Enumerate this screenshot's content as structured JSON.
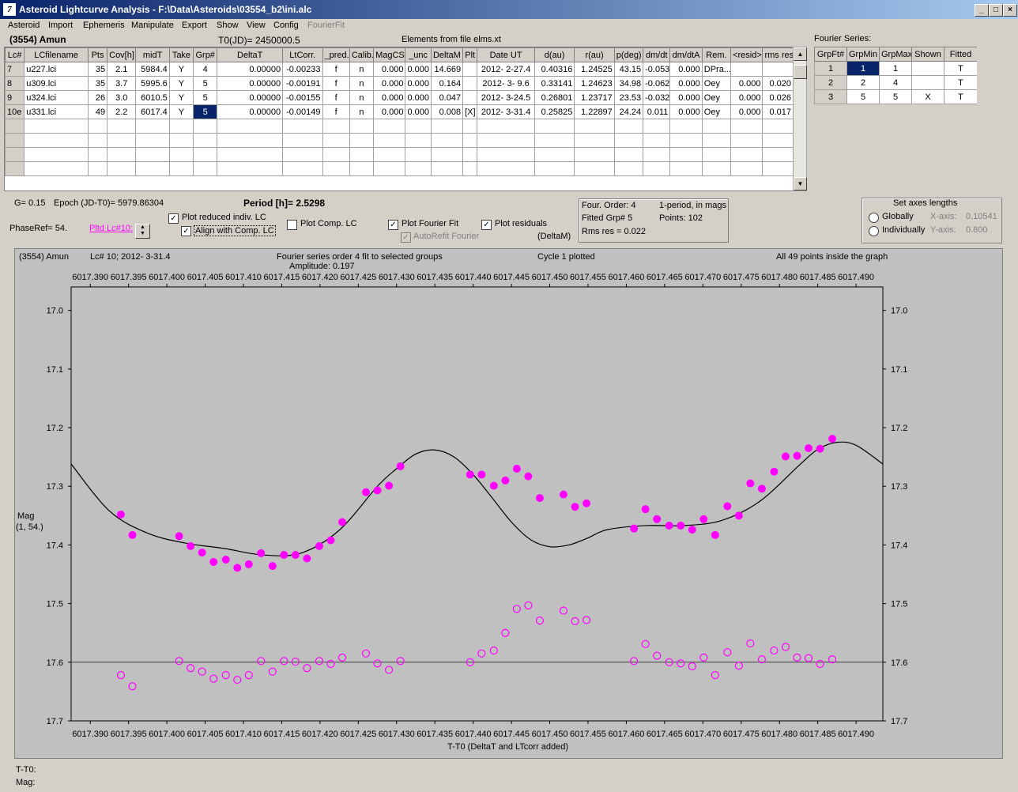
{
  "window": {
    "title": "Asteroid Lightcurve Analysis - F:\\Data\\Asteroids\\03554_b2\\ini.alc",
    "icon": "7"
  },
  "menu": [
    "Asteroid",
    "Import",
    "Ephemeris",
    "Manipulate",
    "Export",
    "Show",
    "View",
    "Config",
    "FourierFit"
  ],
  "header": {
    "asteroid": "(3554) Amun",
    "t0": "T0(JD)= 2450000.5",
    "elements": "Elements from file elms.xt"
  },
  "lc_table": {
    "columns": [
      "Lc#",
      "LCfilename",
      "Pts",
      "Cov[h]",
      "midT",
      "Take",
      "Grp#",
      "DeltaT",
      "LtCorr.",
      "_pred.",
      "Calib.",
      "MagCS",
      "_unc",
      "DeltaM",
      "Plt",
      "Date UT",
      "d(au)",
      "r(au)",
      "p(deg)",
      "dm/dt",
      "dm/dtA",
      "Rem.",
      "<resid>",
      "rms res"
    ],
    "rows": [
      [
        "7",
        "u227.lci",
        "35",
        "2.1",
        "5984.4",
        "Y",
        "4",
        "0.00000",
        "-0.00233",
        "f",
        "n",
        "0.000",
        "0.000",
        "14.669",
        "",
        "2012- 2-27.4",
        "0.40316",
        "1.24525",
        "43.15",
        "-0.053",
        "0.000",
        "DPra...",
        "",
        ""
      ],
      [
        "8",
        "u309.lci",
        "35",
        "3.7",
        "5995.6",
        "Y",
        "5",
        "0.00000",
        "-0.00191",
        "f",
        "n",
        "0.000",
        "0.000",
        "0.164",
        "",
        "2012- 3- 9.6",
        "0.33141",
        "1.24623",
        "34.98",
        "-0.062",
        "0.000",
        "Oey",
        "0.000",
        "0.020"
      ],
      [
        "9",
        "u324.lci",
        "26",
        "3.0",
        "6010.5",
        "Y",
        "5",
        "0.00000",
        "-0.00155",
        "f",
        "n",
        "0.000",
        "0.000",
        "0.047",
        "",
        "2012- 3-24.5",
        "0.26801",
        "1.23717",
        "23.53",
        "-0.032",
        "0.000",
        "Oey",
        "0.000",
        "0.026"
      ],
      [
        "10e",
        "u331.lci",
        "49",
        "2.2",
        "6017.4",
        "Y",
        "5",
        "0.00000",
        "-0.00149",
        "f",
        "n",
        "0.000",
        "0.000",
        "0.008",
        "[X]",
        "2012- 3-31.4",
        "0.25825",
        "1.22897",
        "24.24",
        "0.011",
        "0.000",
        "Oey",
        "0.000",
        "0.017"
      ]
    ]
  },
  "fourier_table": {
    "title": "Fourier Series:",
    "columns": [
      "GrpFt#",
      "GrpMin",
      "GrpMax",
      "Shown",
      "Fitted"
    ],
    "rows": [
      [
        "1",
        "1",
        "1",
        "",
        "T"
      ],
      [
        "2",
        "2",
        "4",
        "",
        "T"
      ],
      [
        "3",
        "5",
        "5",
        "X",
        "T"
      ]
    ]
  },
  "info": {
    "g": "G= 0.15",
    "epoch": "Epoch (JD-T0)= 5979.86304",
    "period": "Period [h]= 2.5298",
    "phaseref": "PhaseRef= 54.",
    "pltd_link": "Pltd Lc#10:",
    "cb_reduced": "Plot reduced indiv. LC",
    "cb_align": "Align with Comp. LC",
    "cb_comp": "Plot Comp. LC",
    "cb_fourier": "Plot Fourier Fit",
    "cb_residuals": "Plot residuals",
    "cb_autorefit": "AutoRefit Fourier",
    "deltam": "(DeltaM)",
    "four_order": "Four. Order:  4",
    "one_period": "1-period, in mags",
    "fitted_grp": "Fitted Grp# 5",
    "points": "Points: 102",
    "rms_res": "Rms res     = 0.022",
    "axes_title": "Set axes lengths",
    "globally": "Globally",
    "individually": "Individually",
    "xaxis": "X-axis:",
    "xaxis_val": "0.10541",
    "yaxis": "Y-axis:",
    "yaxis_val": "0.800"
  },
  "plot_header": {
    "asteroid": "(3554) Amun",
    "lc": "Lc# 10; 2012- 3-31.4",
    "fourier": "Fourier series order 4 fit to selected groups",
    "amplitude": "Amplitude: 0.197",
    "cycle": "Cycle  1 plotted",
    "inside": "All 49 points inside the graph",
    "ylabel1": "Mag",
    "ylabel2": "(1, 54.)",
    "xlabel": "T-T0 (DeltaT and LTcorr added)"
  },
  "status": {
    "tt0": "T-T0:",
    "mag": "Mag:"
  },
  "chart_data": {
    "type": "scatter",
    "xlabel": "T-T0 (DeltaT and LTcorr added)",
    "ylabel": "Mag",
    "xlim": [
      6017.3875,
      6017.4935
    ],
    "ylim": [
      17.7,
      16.96
    ],
    "x_ticks": [
      6017.39,
      6017.395,
      6017.4,
      6017.405,
      6017.41,
      6017.415,
      6017.42,
      6017.425,
      6017.43,
      6017.435,
      6017.44,
      6017.445,
      6017.45,
      6017.455,
      6017.46,
      6017.465,
      6017.47,
      6017.475,
      6017.48,
      6017.485,
      6017.49
    ],
    "x_tick_labels": [
      "6017.390",
      "6017.395",
      "6017.400",
      "6017.405",
      "6017.410",
      "6017.415",
      "6017.420",
      "6017.425",
      "6017.430",
      "6017.435",
      "6017.440",
      "6017.445",
      "6017.450",
      "6017.455",
      "6017.460",
      "6017.465",
      "6017.470",
      "6017.475",
      "6017.480",
      "6017.485",
      "6017.490"
    ],
    "y_ticks": [
      17.0,
      17.1,
      17.2,
      17.3,
      17.4,
      17.5,
      17.6,
      17.7
    ],
    "y_tick_labels": [
      "17.0",
      "17.1",
      "17.2",
      "17.3",
      "17.4",
      "17.5",
      "17.6",
      "17.7"
    ],
    "residual_baseline": 17.6,
    "colors": {
      "points": "#ff00ff",
      "fit": "#000000",
      "plot_bg": "#c0c0c0"
    },
    "series": [
      {
        "kind": "observed",
        "x": [
          6017.394,
          6017.3955,
          6017.4016,
          6017.4031,
          6017.4046,
          6017.4061,
          6017.4077,
          6017.4092,
          6017.4107,
          6017.4123,
          6017.4138,
          6017.4153,
          6017.4168,
          6017.4183,
          6017.4199,
          6017.4214,
          6017.4229,
          6017.426,
          6017.4275,
          6017.429,
          6017.4305,
          6017.4396,
          6017.4411,
          6017.4427,
          6017.4442,
          6017.4457,
          6017.4472,
          6017.4487,
          6017.4518,
          6017.4533,
          6017.4548,
          6017.461,
          6017.4625,
          6017.464,
          6017.4656,
          6017.4671,
          6017.4686,
          6017.4701,
          6017.4716,
          6017.4732,
          6017.4747,
          6017.4762,
          6017.4777,
          6017.4793,
          6017.4808,
          6017.4823,
          6017.4838,
          6017.4853,
          6017.4869
        ],
        "y": [
          17.348,
          17.383,
          17.385,
          17.402,
          17.413,
          17.429,
          17.425,
          17.439,
          17.433,
          17.414,
          17.436,
          17.417,
          17.417,
          17.423,
          17.402,
          17.392,
          17.361,
          17.31,
          17.307,
          17.299,
          17.266,
          17.28,
          17.28,
          17.299,
          17.29,
          17.27,
          17.283,
          17.32,
          17.314,
          17.335,
          17.329,
          17.372,
          17.339,
          17.356,
          17.367,
          17.367,
          17.374,
          17.356,
          17.383,
          17.334,
          17.35,
          17.295,
          17.304,
          17.275,
          17.249,
          17.248,
          17.235,
          17.236,
          17.219
        ]
      },
      {
        "kind": "residual",
        "x": [
          6017.394,
          6017.3955,
          6017.4016,
          6017.4031,
          6017.4046,
          6017.4061,
          6017.4077,
          6017.4092,
          6017.4107,
          6017.4123,
          6017.4138,
          6017.4153,
          6017.4168,
          6017.4183,
          6017.4199,
          6017.4214,
          6017.4229,
          6017.426,
          6017.4275,
          6017.429,
          6017.4305,
          6017.4396,
          6017.4411,
          6017.4427,
          6017.4442,
          6017.4457,
          6017.4472,
          6017.4487,
          6017.4518,
          6017.4533,
          6017.4548,
          6017.461,
          6017.4625,
          6017.464,
          6017.4656,
          6017.4671,
          6017.4686,
          6017.4701,
          6017.4716,
          6017.4732,
          6017.4747,
          6017.4762,
          6017.4777,
          6017.4793,
          6017.4808,
          6017.4823,
          6017.4838,
          6017.4853,
          6017.4869
        ],
        "y": [
          17.622,
          17.641,
          17.598,
          17.61,
          17.616,
          17.628,
          17.622,
          17.63,
          17.622,
          17.598,
          17.616,
          17.598,
          17.599,
          17.61,
          17.598,
          17.603,
          17.592,
          17.585,
          17.602,
          17.613,
          17.598,
          17.6,
          17.585,
          17.58,
          17.55,
          17.509,
          17.503,
          17.529,
          17.512,
          17.53,
          17.528,
          17.598,
          17.569,
          17.589,
          17.6,
          17.602,
          17.607,
          17.592,
          17.622,
          17.583,
          17.606,
          17.568,
          17.595,
          17.58,
          17.574,
          17.592,
          17.593,
          17.603,
          17.595
        ]
      },
      {
        "kind": "fourier_fit",
        "x": [
          6017.3875,
          6017.3925,
          6017.3975,
          6017.4025,
          6017.4075,
          6017.4125,
          6017.4175,
          6017.4225,
          6017.4275,
          6017.43,
          6017.4325,
          6017.435,
          6017.4375,
          6017.44,
          6017.4425,
          6017.445,
          6017.4475,
          6017.45,
          6017.4525,
          6017.455,
          6017.4575,
          6017.4625,
          6017.4675,
          6017.4725,
          6017.4775,
          6017.4825,
          6017.485,
          6017.4875,
          6017.49,
          6017.4935
        ],
        "y": [
          17.262,
          17.342,
          17.38,
          17.397,
          17.406,
          17.417,
          17.414,
          17.375,
          17.3,
          17.27,
          17.245,
          17.238,
          17.25,
          17.28,
          17.32,
          17.361,
          17.391,
          17.403,
          17.4,
          17.388,
          17.374,
          17.367,
          17.367,
          17.358,
          17.325,
          17.265,
          17.237,
          17.225,
          17.23,
          17.262
        ]
      }
    ]
  }
}
